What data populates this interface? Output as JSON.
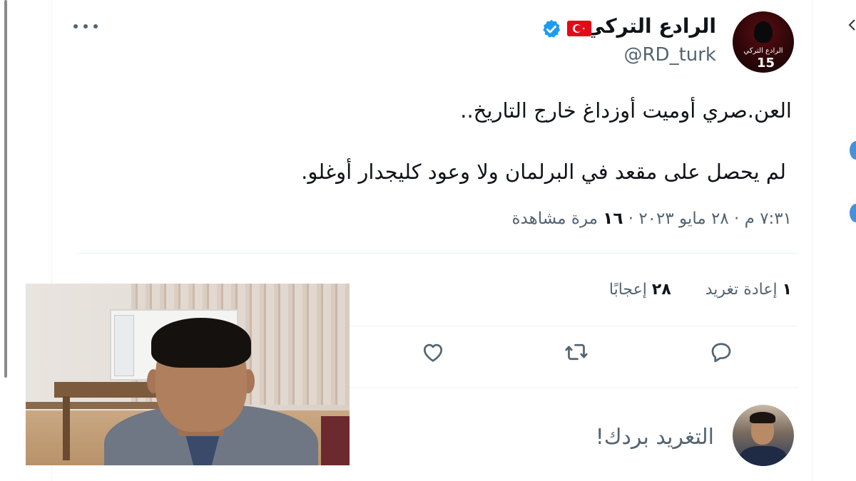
{
  "tweet": {
    "display_name": "الرادع التركي",
    "handle": "@RD_turk",
    "avatar_label": "الرادع التركي",
    "avatar_number": "15",
    "flag": "turkey-flag",
    "verified": true,
    "line1": "العن.صري أوميت أوزداغ خارج التاريخ..",
    "line2": "لم يحصل على مقعد في البرلمان ولا وعود كليجدار أوغلو.",
    "time": "٧:٣١ م",
    "date": "٢٨ مايو ٢٠٢٣",
    "views_count": "١٦",
    "views_label": "مرة مشاهدة",
    "separator": "·"
  },
  "stats": {
    "retweets_count": "١",
    "retweets_label": "إعادة تغريد",
    "likes_count": "٢٨",
    "likes_label": "إعجابًا"
  },
  "reply": {
    "placeholder": "التغريد بردك!"
  },
  "colors": {
    "accent": "#1d9bf0",
    "text": "#0f1419",
    "muted": "#536471",
    "flag_red": "#e30a17"
  }
}
